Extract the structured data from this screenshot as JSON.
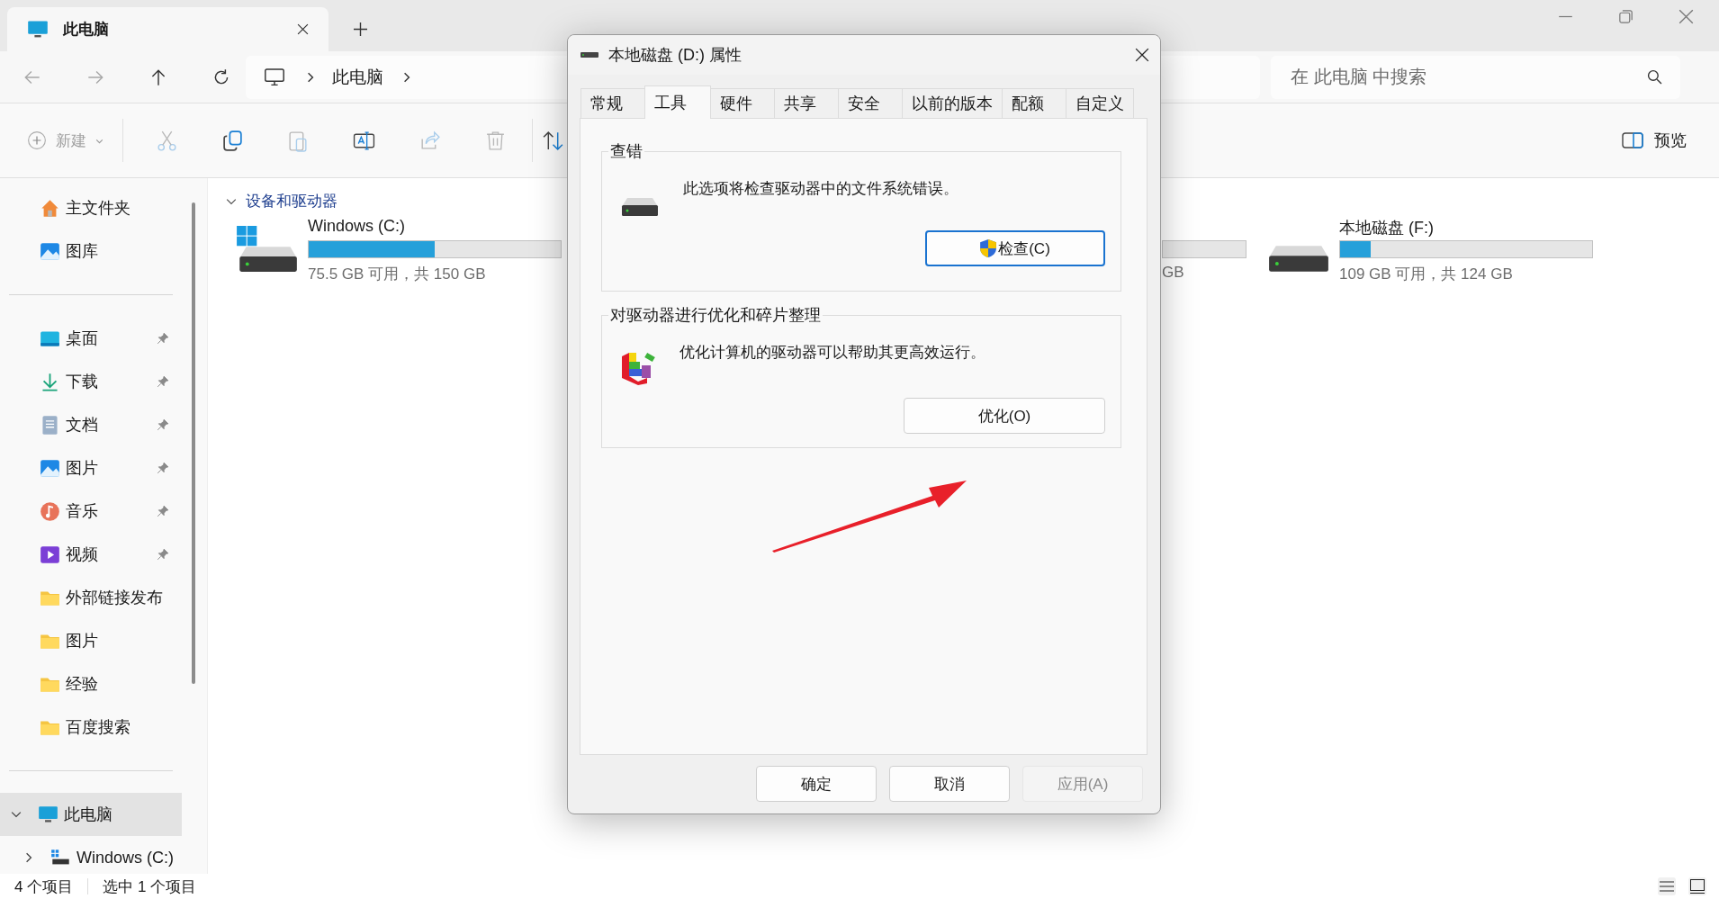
{
  "window": {
    "tab_title": "此电脑"
  },
  "nav": {
    "buttons": [
      {
        "kind": "back",
        "disabled": true
      },
      {
        "kind": "forward",
        "disabled": true
      },
      {
        "kind": "up",
        "disabled": false
      },
      {
        "kind": "refresh",
        "disabled": false
      }
    ],
    "breadcrumb": [
      "此电脑"
    ],
    "search": {
      "placeholder": "在 此电脑 中搜索"
    }
  },
  "toolbar": {
    "new": {
      "label": "新建",
      "disabled": true
    },
    "actions": [
      {
        "kind": "cut",
        "disabled": true
      },
      {
        "kind": "copy",
        "disabled": false
      },
      {
        "kind": "paste",
        "disabled": true
      },
      {
        "kind": "rename",
        "disabled": false
      },
      {
        "kind": "share",
        "disabled": true
      },
      {
        "kind": "delete",
        "disabled": true
      },
      {
        "kind": "sort",
        "disabled": false
      }
    ],
    "preview": "预览"
  },
  "sidebar": {
    "sections": [
      {
        "items": [
          {
            "label": "主文件夹",
            "kind": "home",
            "pinned": false,
            "selected": false
          },
          {
            "label": "图库",
            "kind": "gallery",
            "pinned": false,
            "selected": false
          }
        ]
      },
      {
        "items": [
          {
            "label": "桌面",
            "kind": "desktop",
            "pinned": true,
            "selected": false
          },
          {
            "label": "下载",
            "kind": "downloads",
            "pinned": true,
            "selected": false
          },
          {
            "label": "文档",
            "kind": "documents",
            "pinned": true,
            "selected": false
          },
          {
            "label": "图片",
            "kind": "pictures",
            "pinned": true,
            "selected": false
          },
          {
            "label": "音乐",
            "kind": "music",
            "pinned": true,
            "selected": false
          },
          {
            "label": "视频",
            "kind": "videos",
            "pinned": true,
            "selected": false
          },
          {
            "label": "外部链接发布",
            "kind": "folder",
            "pinned": false,
            "selected": false
          },
          {
            "label": "图片",
            "kind": "folder",
            "pinned": false,
            "selected": false
          },
          {
            "label": "经验",
            "kind": "folder",
            "pinned": false,
            "selected": false
          },
          {
            "label": "百度搜索",
            "kind": "folder",
            "pinned": false,
            "selected": false
          }
        ]
      },
      {
        "items": [
          {
            "label": "此电脑",
            "kind": "pc",
            "pinned": false,
            "selected": true,
            "expanded": true,
            "children": [
              {
                "label": "Windows (C:)",
                "kind": "drive",
                "pinned": false,
                "selected": false,
                "expanded": false
              }
            ]
          }
        ]
      }
    ]
  },
  "content": {
    "section": {
      "title": "设备和驱动器",
      "expanded": true
    },
    "drives": [
      {
        "kind": "system",
        "name": "Windows (C:)",
        "level": 0.5,
        "reading": "75.5 GB 可用，共 150 GB"
      },
      {
        "kind": "partial",
        "reading": "GB"
      },
      {
        "kind": "disk",
        "name": "本地磁盘 (F:)",
        "level": 0.12,
        "reading": "109 GB 可用，共 124 GB"
      }
    ]
  },
  "status_bar": {
    "items": [
      "4 个项目",
      "选中 1 个项目"
    ]
  },
  "dialog": {
    "title": "本地磁盘 (D:) 属性",
    "tabs": [
      {
        "label": "常规",
        "selected": false
      },
      {
        "label": "工具",
        "selected": true
      },
      {
        "label": "硬件",
        "selected": false
      },
      {
        "label": "共享",
        "selected": false
      },
      {
        "label": "安全",
        "selected": false
      },
      {
        "label": "以前的版本",
        "selected": false
      },
      {
        "label": "配额",
        "selected": false
      },
      {
        "label": "自定义",
        "selected": false
      }
    ],
    "groups": [
      {
        "kind": "check",
        "title": "查错",
        "text": "此选项将检查驱动器中的文件系统错误。",
        "button": "检查(C)",
        "focused": true
      },
      {
        "kind": "optimize",
        "title": "对驱动器进行优化和碎片整理",
        "text": "优化计算机的驱动器可以帮助其更高效运行。",
        "button": "优化(O)",
        "focused": false
      }
    ],
    "buttons": [
      {
        "label": "确定",
        "disabled": false
      },
      {
        "label": "取消",
        "disabled": false
      },
      {
        "label": "应用(A)",
        "disabled": true
      }
    ]
  }
}
